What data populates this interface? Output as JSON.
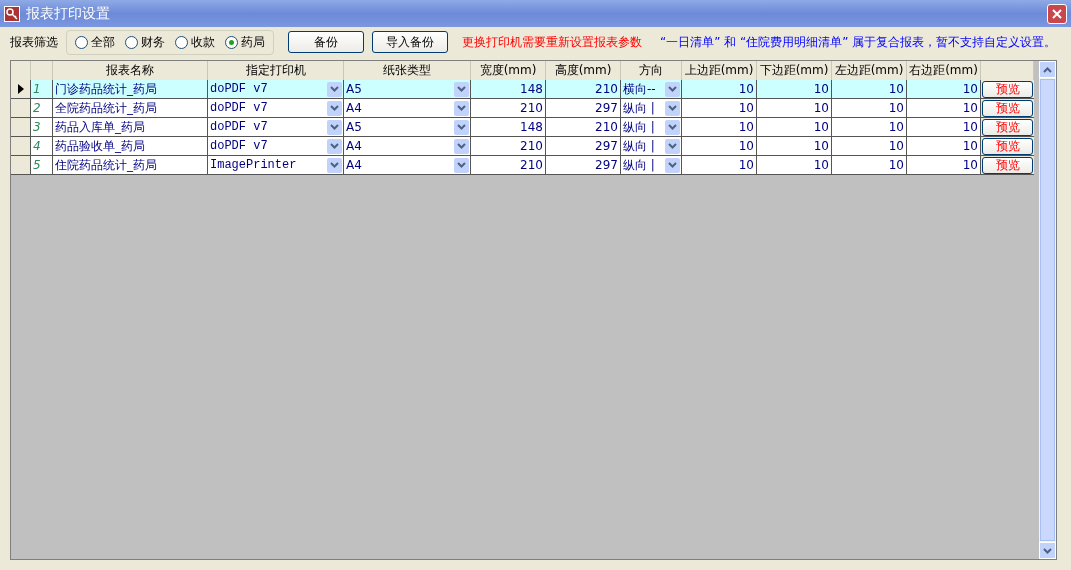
{
  "window": {
    "title": "报表打印设置"
  },
  "filter": {
    "label": "报表筛选",
    "options": [
      {
        "label": "全部",
        "selected": false
      },
      {
        "label": "财务",
        "selected": false
      },
      {
        "label": "收款",
        "selected": false
      },
      {
        "label": "药局",
        "selected": true
      }
    ]
  },
  "buttons": [
    "备份",
    "导入备份"
  ],
  "notes": [
    {
      "kind": "warning",
      "text": "更换打印机需要重新设置报表参数"
    },
    {
      "kind": "info",
      "text": "“一日清单” 和 “住院费用明细清单” 属于复合报表，暂不支持自定义设置。"
    }
  ],
  "table": {
    "columns": [
      {
        "label": "报表名称",
        "kind": "text"
      },
      {
        "label": "指定打印机",
        "kind": "combo"
      },
      {
        "label": "纸张类型",
        "kind": "combo"
      },
      {
        "label": "宽度(mm)",
        "kind": "number"
      },
      {
        "label": "高度(mm)",
        "kind": "number"
      },
      {
        "label": "方向",
        "kind": "combo"
      },
      {
        "label": "上边距(mm)",
        "kind": "number"
      },
      {
        "label": "下边距(mm)",
        "kind": "number"
      },
      {
        "label": "左边距(mm)",
        "kind": "number"
      },
      {
        "label": "右边距(mm)",
        "kind": "number"
      }
    ],
    "rows": [
      {
        "index": "1",
        "selected": true,
        "cells": [
          "门诊药品统计_药局",
          "doPDF v7",
          "A5",
          "148",
          "210",
          "横向--",
          "10",
          "10",
          "10",
          "10"
        ],
        "button": "预览"
      },
      {
        "index": "2",
        "selected": false,
        "cells": [
          "全院药品统计_药局",
          "doPDF v7",
          "A4",
          "210",
          "297",
          "纵向 |",
          "10",
          "10",
          "10",
          "10"
        ],
        "button": "预览"
      },
      {
        "index": "3",
        "selected": false,
        "cells": [
          "药品入库单_药局",
          "doPDF v7",
          "A5",
          "148",
          "210",
          "纵向 |",
          "10",
          "10",
          "10",
          "10"
        ],
        "button": "预览"
      },
      {
        "index": "4",
        "selected": false,
        "cells": [
          "药品验收单_药局",
          "doPDF v7",
          "A4",
          "210",
          "297",
          "纵向 |",
          "10",
          "10",
          "10",
          "10"
        ],
        "button": "预览"
      },
      {
        "index": "5",
        "selected": false,
        "cells": [
          "住院药品统计_药局",
          "ImagePrinter",
          "A4",
          "210",
          "297",
          "纵向 |",
          "10",
          "10",
          "10",
          "10"
        ],
        "button": "预览"
      }
    ]
  }
}
